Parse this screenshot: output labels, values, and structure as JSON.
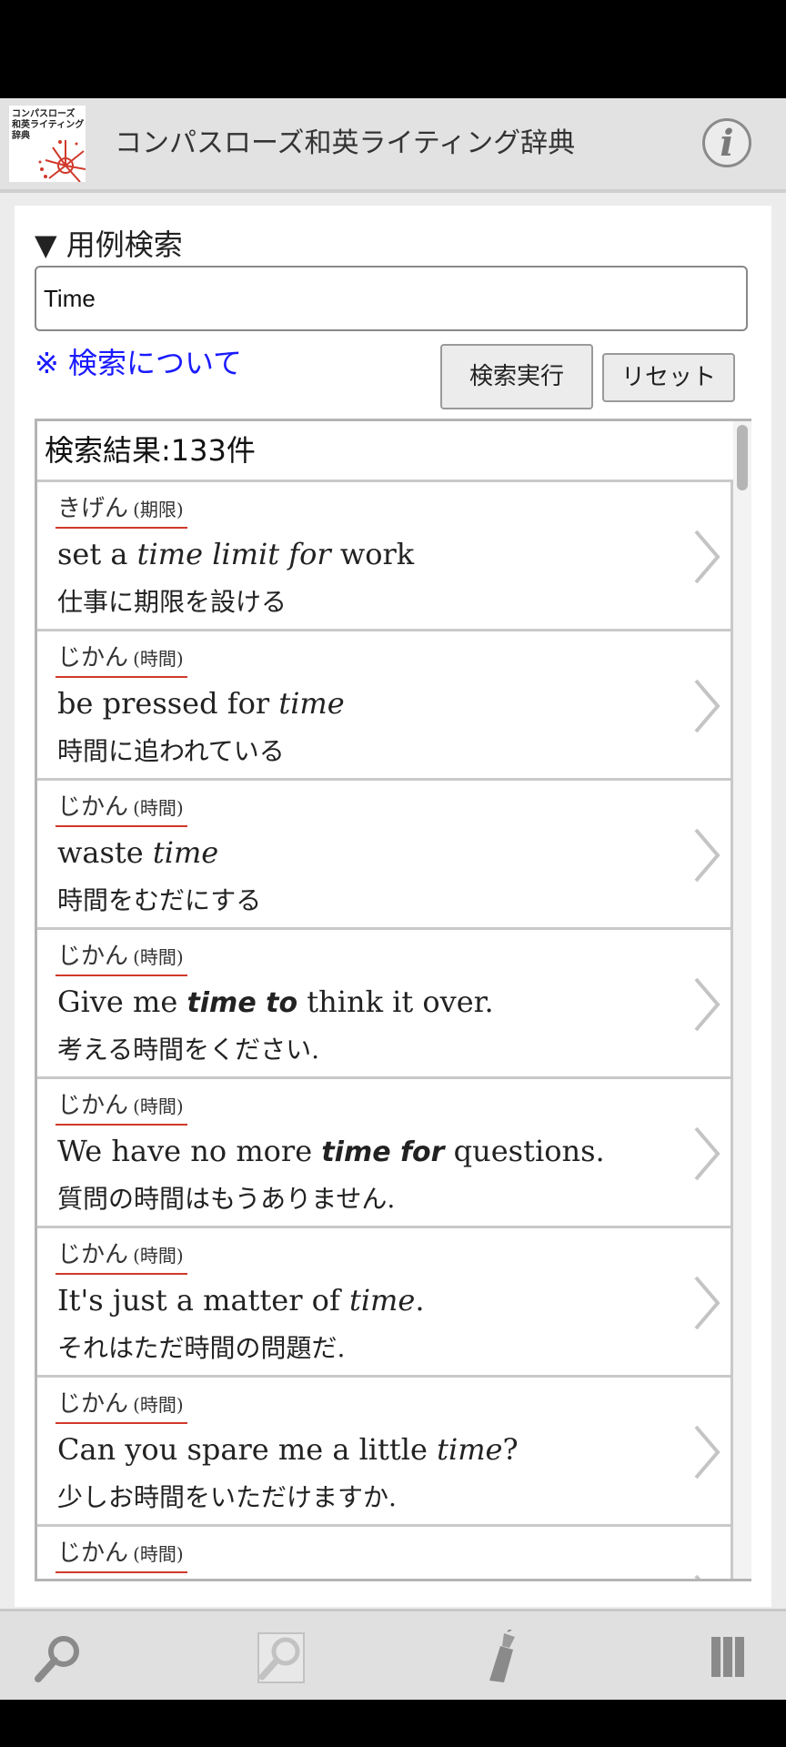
{
  "header": {
    "app_title": "コンパスローズ和英ライティング辞典",
    "logo_lines": [
      "コンパスローズ",
      "和英ライティング",
      "辞典"
    ],
    "info_icon": "info-icon"
  },
  "search": {
    "section_title": "▼ 用例検索",
    "input_value": "Time",
    "help_link": "※ 検索について",
    "search_button": "検索実行",
    "reset_button": "リセット"
  },
  "results": {
    "count_label": "検索結果:133件",
    "items": [
      {
        "kana": "きげん",
        "kanji": "(期限)",
        "en": [
          {
            "t": "set a "
          },
          {
            "t": "time limit for",
            "s": "em"
          },
          {
            "t": " work"
          }
        ],
        "ja": "仕事に期限を設ける"
      },
      {
        "kana": "じかん",
        "kanji": "(時間)",
        "en": [
          {
            "t": "be pressed for "
          },
          {
            "t": "time",
            "s": "em"
          }
        ],
        "ja": "時間に追われている"
      },
      {
        "kana": "じかん",
        "kanji": "(時間)",
        "en": [
          {
            "t": "waste "
          },
          {
            "t": "time",
            "s": "em"
          }
        ],
        "ja": "時間をむだにする"
      },
      {
        "kana": "じかん",
        "kanji": "(時間)",
        "en": [
          {
            "t": "Give me "
          },
          {
            "t": "time to",
            "s": "em-bold"
          },
          {
            "t": " think it over."
          }
        ],
        "ja": "考える時間をください."
      },
      {
        "kana": "じかん",
        "kanji": "(時間)",
        "en": [
          {
            "t": "We have no more "
          },
          {
            "t": "time for",
            "s": "em-bold"
          },
          {
            "t": " questions."
          }
        ],
        "ja": "質問の時間はもうありません."
      },
      {
        "kana": "じかん",
        "kanji": "(時間)",
        "en": [
          {
            "t": "It's just a matter of "
          },
          {
            "t": "time",
            "s": "em"
          },
          {
            "t": "."
          }
        ],
        "ja": "それはただ時間の問題だ."
      },
      {
        "kana": "じかん",
        "kanji": "(時間)",
        "en": [
          {
            "t": "Can you spare me a little "
          },
          {
            "t": "time",
            "s": "em"
          },
          {
            "t": "?"
          }
        ],
        "ja": "少しお時間をいただけますか."
      },
      {
        "kana": "じかん",
        "kanji": "(時間)",
        "en": [],
        "ja": ""
      }
    ]
  },
  "toolbar": {
    "icons": [
      "search-icon",
      "search-disabled-icon",
      "eraser-icon",
      "columns-icon"
    ]
  },
  "colors": {
    "link": "#1a1aff",
    "reading_underline": "#d0392b",
    "header_bg": "#e2e2e2"
  }
}
